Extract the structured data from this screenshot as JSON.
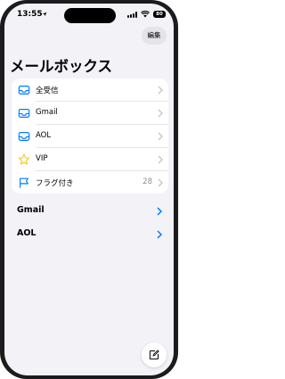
{
  "status_bar": {
    "time": "13:55",
    "battery": "80"
  },
  "toolbar": {
    "edit_label": "編集"
  },
  "page_title": "メールボックス",
  "mailboxes": [
    {
      "label": "全受信",
      "icon": "inbox-icon",
      "count": ""
    },
    {
      "label": "Gmail",
      "icon": "inbox-icon",
      "count": ""
    },
    {
      "label": "AOL",
      "icon": "inbox-icon",
      "count": ""
    },
    {
      "label": "VIP",
      "icon": "star-icon",
      "count": ""
    },
    {
      "label": "フラグ付き",
      "icon": "flag-icon",
      "count": "28"
    }
  ],
  "accounts": [
    {
      "label": "Gmail"
    },
    {
      "label": "AOL"
    }
  ],
  "colors": {
    "accent": "#007aff",
    "vip": "#f5c518",
    "background": "#f2f2f7"
  }
}
